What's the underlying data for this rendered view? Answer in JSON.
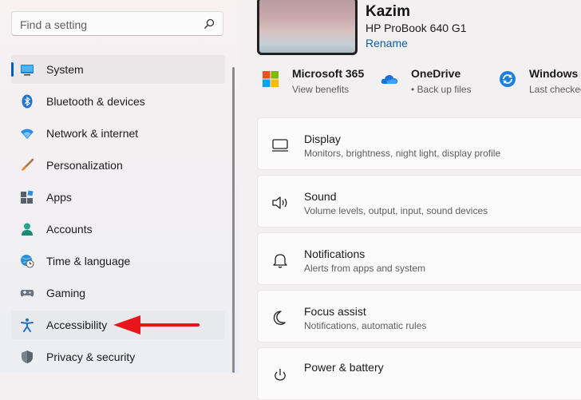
{
  "search": {
    "placeholder": "Find a setting",
    "icon": "search-icon"
  },
  "sidebar": {
    "items": [
      {
        "label": "System",
        "icon": "system-display-icon",
        "state": "selected"
      },
      {
        "label": "Bluetooth & devices",
        "icon": "bluetooth-icon"
      },
      {
        "label": "Network & internet",
        "icon": "wifi-icon"
      },
      {
        "label": "Personalization",
        "icon": "brush-icon"
      },
      {
        "label": "Apps",
        "icon": "apps-icon"
      },
      {
        "label": "Accounts",
        "icon": "person-icon"
      },
      {
        "label": "Time & language",
        "icon": "globe-clock-icon"
      },
      {
        "label": "Gaming",
        "icon": "gamepad-icon"
      },
      {
        "label": "Accessibility",
        "icon": "accessibility-icon",
        "state": "hover"
      },
      {
        "label": "Privacy & security",
        "icon": "shield-icon"
      }
    ]
  },
  "device": {
    "name": "Kazim",
    "model": "HP ProBook 640 G1",
    "rename_label": "Rename"
  },
  "tiles": [
    {
      "title": "Microsoft 365",
      "subtitle": "View benefits",
      "icon": "microsoft-logo-icon"
    },
    {
      "title": "OneDrive",
      "subtitle": "• Back up files",
      "icon": "onedrive-cloud-icon"
    },
    {
      "title": "Windows Update",
      "subtitle": "Last checked",
      "icon": "windows-update-icon"
    }
  ],
  "cards": [
    {
      "title": "Display",
      "subtitle": "Monitors, brightness, night light, display profile",
      "icon": "monitor-icon"
    },
    {
      "title": "Sound",
      "subtitle": "Volume levels, output, input, sound devices",
      "icon": "speaker-icon"
    },
    {
      "title": "Notifications",
      "subtitle": "Alerts from apps and system",
      "icon": "bell-icon"
    },
    {
      "title": "Focus assist",
      "subtitle": "Notifications, automatic rules",
      "icon": "moon-icon"
    },
    {
      "title": "Power & battery",
      "subtitle": "",
      "icon": "power-icon"
    }
  ],
  "colors": {
    "accent": "#005fb8",
    "annotation_arrow": "#e8161b",
    "link": "#0e5ea8"
  }
}
